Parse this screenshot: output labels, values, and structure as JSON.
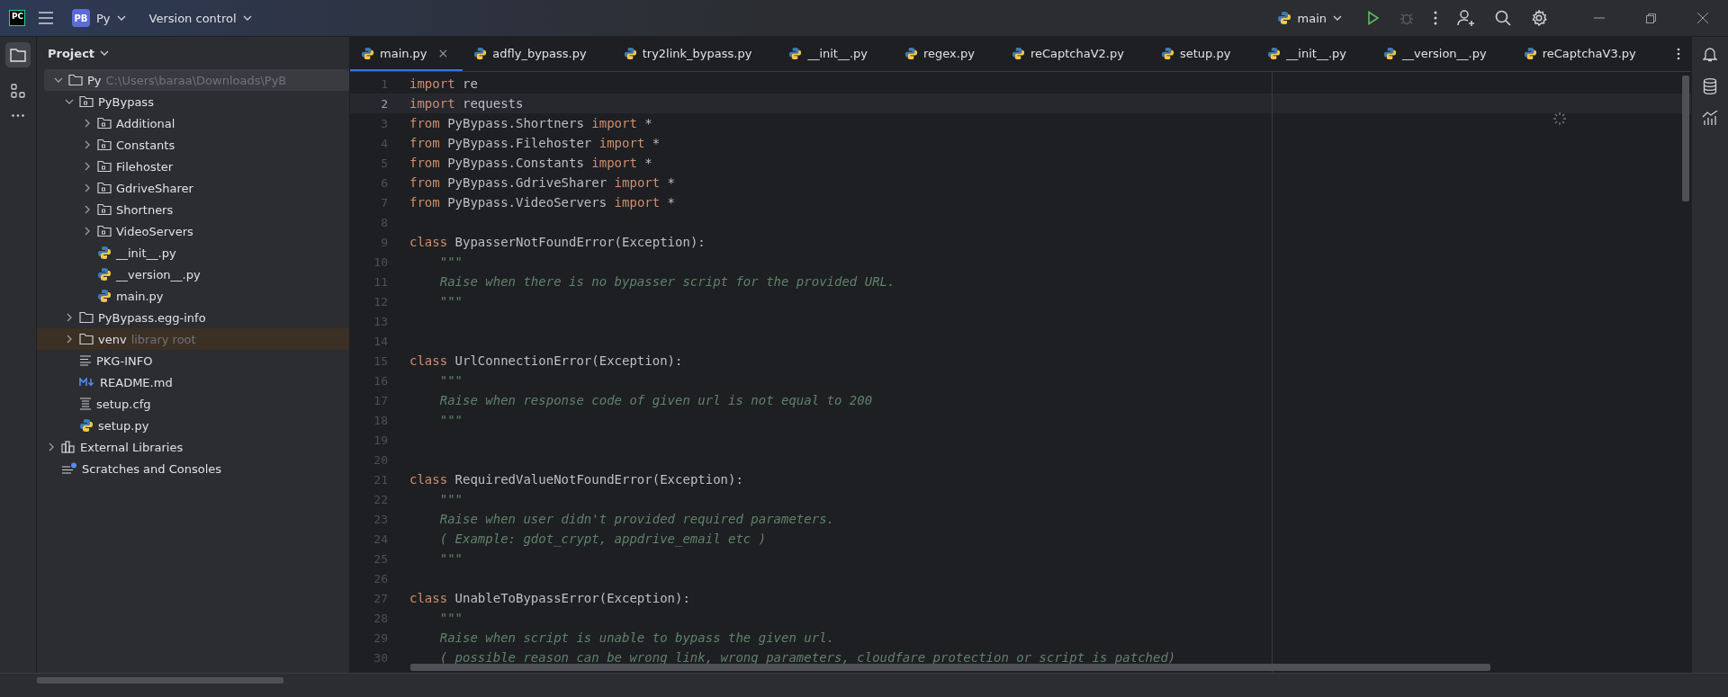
{
  "title_bar": {
    "logo": "PC",
    "project_badge": "PB",
    "project_name": "Py",
    "vcs": "Version control",
    "branch": "main",
    "debug_disabled": true
  },
  "project": {
    "title": "Project",
    "tree": [
      {
        "label": "Py",
        "path": "C:\\Users\\baraa\\Downloads\\PyB",
        "kind": "folder",
        "expanded": true,
        "selected": true,
        "children": [
          {
            "label": "PyBypass",
            "kind": "package",
            "expanded": true,
            "selected": false,
            "children": [
              {
                "label": "Additional",
                "kind": "package",
                "expanded": false,
                "selected": false
              },
              {
                "label": "Constants",
                "kind": "package",
                "expanded": false,
                "selected": false
              },
              {
                "label": "Filehoster",
                "kind": "package",
                "expanded": false,
                "selected": false
              },
              {
                "label": "GdriveSharer",
                "kind": "package",
                "expanded": false,
                "selected": false
              },
              {
                "label": "Shortners",
                "kind": "package",
                "expanded": false,
                "selected": false
              },
              {
                "label": "VideoServers",
                "kind": "package",
                "expanded": false,
                "selected": false
              },
              {
                "label": "__init__.py",
                "kind": "python",
                "selected": false
              },
              {
                "label": "__version__.py",
                "kind": "python",
                "selected": false
              },
              {
                "label": "main.py",
                "kind": "python",
                "selected": false
              }
            ]
          },
          {
            "label": "PyBypass.egg-info",
            "kind": "folder",
            "expanded": false,
            "selected": false
          },
          {
            "label": "venv",
            "hint": "library root",
            "kind": "library_folder",
            "expanded": false,
            "selected": false
          },
          {
            "label": "PKG-INFO",
            "kind": "text",
            "selected": false
          },
          {
            "label": "README.md",
            "kind": "markdown",
            "selected": false
          },
          {
            "label": "setup.cfg",
            "kind": "config",
            "selected": false
          },
          {
            "label": "setup.py",
            "kind": "python",
            "selected": false
          }
        ]
      },
      {
        "label": "External Libraries",
        "kind": "libraries",
        "expanded": false,
        "selected": false
      },
      {
        "label": "Scratches and Consoles",
        "kind": "scratches",
        "selected": false
      }
    ]
  },
  "tabs": [
    {
      "label": "main.py",
      "selected": true,
      "close": "×"
    },
    {
      "label": "adfly_bypass.py",
      "selected": false
    },
    {
      "label": "try2link_bypass.py",
      "selected": false
    },
    {
      "label": "__init__.py",
      "selected": false
    },
    {
      "label": "regex.py",
      "selected": false
    },
    {
      "label": "reCaptchaV2.py",
      "selected": false
    },
    {
      "label": "setup.py",
      "selected": false
    },
    {
      "label": "__init__.py",
      "selected": false
    },
    {
      "label": "__version__.py",
      "selected": false
    },
    {
      "label": "reCaptchaV3.py",
      "selected": false
    }
  ],
  "code": [
    {
      "number": "1",
      "current": false,
      "tokens": [
        {
          "kind": "keyword",
          "text": "import"
        },
        {
          "kind": "plain",
          "text": " re"
        }
      ]
    },
    {
      "number": "2",
      "current": true,
      "tokens": [
        {
          "kind": "keyword",
          "text": "import"
        },
        {
          "kind": "plain",
          "text": " requests"
        }
      ]
    },
    {
      "number": "3",
      "current": false,
      "tokens": [
        {
          "kind": "keyword",
          "text": "from"
        },
        {
          "kind": "plain",
          "text": " PyBypass.Shortners "
        },
        {
          "kind": "keyword",
          "text": "import"
        },
        {
          "kind": "plain",
          "text": " *"
        }
      ]
    },
    {
      "number": "4",
      "current": false,
      "tokens": [
        {
          "kind": "keyword",
          "text": "from"
        },
        {
          "kind": "plain",
          "text": " PyBypass.Filehoster "
        },
        {
          "kind": "keyword",
          "text": "import"
        },
        {
          "kind": "plain",
          "text": " *"
        }
      ]
    },
    {
      "number": "5",
      "current": false,
      "tokens": [
        {
          "kind": "keyword",
          "text": "from"
        },
        {
          "kind": "plain",
          "text": " PyBypass.Constants "
        },
        {
          "kind": "keyword",
          "text": "import"
        },
        {
          "kind": "plain",
          "text": " *"
        }
      ]
    },
    {
      "number": "6",
      "current": false,
      "tokens": [
        {
          "kind": "keyword",
          "text": "from"
        },
        {
          "kind": "plain",
          "text": " PyBypass.GdriveSharer "
        },
        {
          "kind": "keyword",
          "text": "import"
        },
        {
          "kind": "plain",
          "text": " *"
        }
      ]
    },
    {
      "number": "7",
      "current": false,
      "tokens": [
        {
          "kind": "keyword",
          "text": "from"
        },
        {
          "kind": "plain",
          "text": " PyBypass.VideoServers "
        },
        {
          "kind": "keyword",
          "text": "import"
        },
        {
          "kind": "plain",
          "text": " *"
        }
      ]
    },
    {
      "number": "8",
      "current": false
    },
    {
      "number": "9",
      "current": false,
      "tokens": [
        {
          "kind": "keyword",
          "text": "class"
        },
        {
          "kind": "plain",
          "text": " BypasserNotFoundError(Exception):"
        }
      ]
    },
    {
      "number": "10",
      "current": false,
      "tokens": [
        {
          "kind": "doc",
          "text": "    \"\"\""
        }
      ]
    },
    {
      "number": "11",
      "current": false,
      "tokens": [
        {
          "kind": "doc",
          "text": "    Raise when there is no bypasser script for the provided URL."
        }
      ]
    },
    {
      "number": "12",
      "current": false,
      "tokens": [
        {
          "kind": "doc",
          "text": "    \"\"\""
        }
      ]
    },
    {
      "number": "13",
      "current": false
    },
    {
      "number": "14",
      "current": false
    },
    {
      "number": "15",
      "current": false,
      "tokens": [
        {
          "kind": "keyword",
          "text": "class"
        },
        {
          "kind": "plain",
          "text": " UrlConnectionError(Exception):"
        }
      ]
    },
    {
      "number": "16",
      "current": false,
      "tokens": [
        {
          "kind": "doc",
          "text": "    \"\"\""
        }
      ]
    },
    {
      "number": "17",
      "current": false,
      "tokens": [
        {
          "kind": "doc",
          "text": "    Raise when response code of given url is not equal to 200"
        }
      ]
    },
    {
      "number": "18",
      "current": false,
      "tokens": [
        {
          "kind": "doc",
          "text": "    \"\"\""
        }
      ]
    },
    {
      "number": "19",
      "current": false
    },
    {
      "number": "20",
      "current": false
    },
    {
      "number": "21",
      "current": false,
      "tokens": [
        {
          "kind": "keyword",
          "text": "class"
        },
        {
          "kind": "plain",
          "text": " RequiredValueNotFoundError(Exception):"
        }
      ]
    },
    {
      "number": "22",
      "current": false,
      "tokens": [
        {
          "kind": "doc",
          "text": "    \"\"\""
        }
      ]
    },
    {
      "number": "23",
      "current": false,
      "tokens": [
        {
          "kind": "doc",
          "text": "    Raise when user didn't provided required parameters."
        }
      ]
    },
    {
      "number": "24",
      "current": false,
      "tokens": [
        {
          "kind": "doc",
          "text": "    ( Example: gdot_crypt, appdrive_email etc )"
        }
      ]
    },
    {
      "number": "25",
      "current": false,
      "tokens": [
        {
          "kind": "doc",
          "text": "    \"\"\""
        }
      ]
    },
    {
      "number": "26",
      "current": false
    },
    {
      "number": "27",
      "current": false,
      "tokens": [
        {
          "kind": "keyword",
          "text": "class"
        },
        {
          "kind": "plain",
          "text": " UnableToBypassError(Exception):"
        }
      ]
    },
    {
      "number": "28",
      "current": false,
      "tokens": [
        {
          "kind": "doc",
          "text": "    \"\"\""
        }
      ]
    },
    {
      "number": "29",
      "current": false,
      "tokens": [
        {
          "kind": "doc",
          "text": "    Raise when script is unable to bypass the given url."
        }
      ]
    },
    {
      "number": "30",
      "current": false,
      "tokens": [
        {
          "kind": "doc",
          "text": "    ( possible reason can be wrong link, wrong parameters, cloudfare protection or script is patched)"
        }
      ]
    }
  ]
}
